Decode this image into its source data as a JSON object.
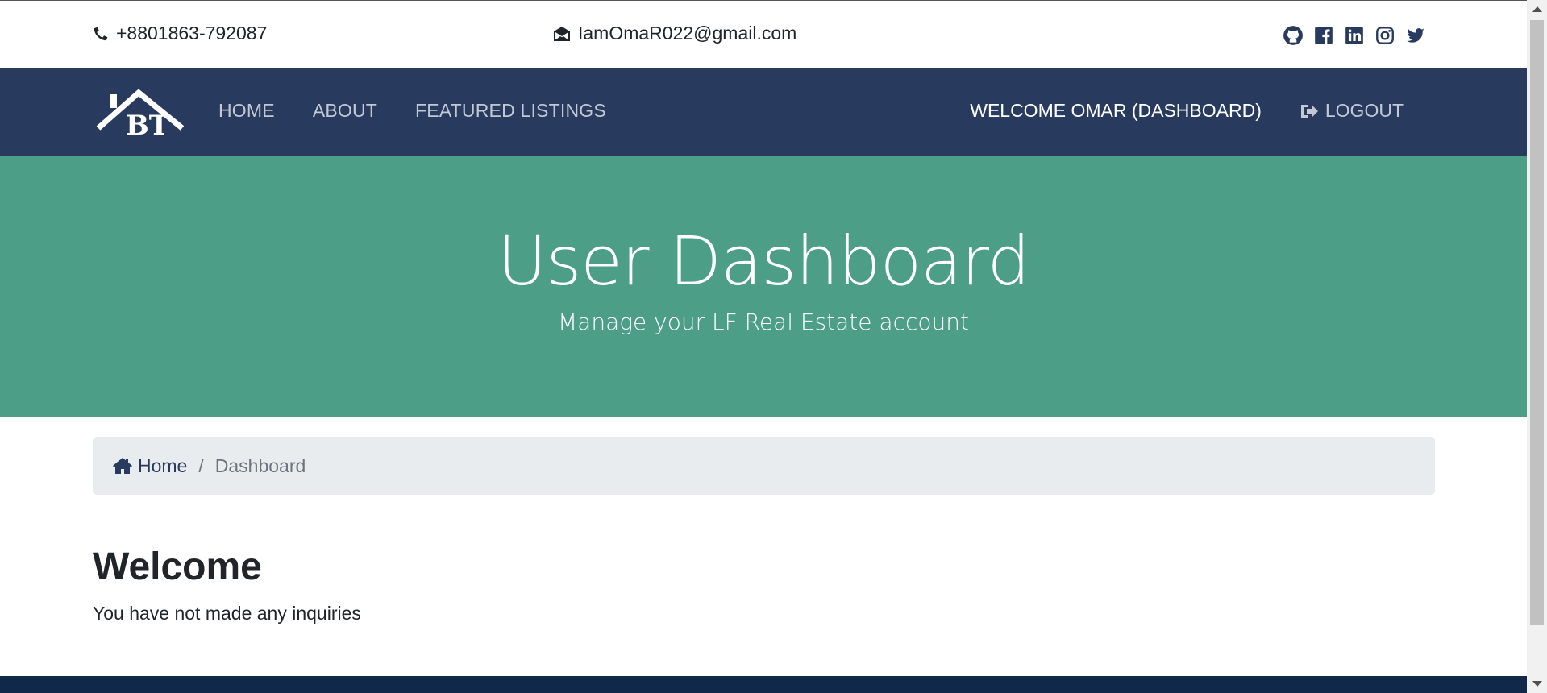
{
  "contact": {
    "phone": "+8801863-792087",
    "email": "IamOmaR022@gmail.com"
  },
  "social_icons": [
    "github-icon",
    "facebook-icon",
    "linkedin-icon",
    "instagram-icon",
    "twitter-icon"
  ],
  "nav": {
    "logo_text": "BT",
    "links": [
      "HOME",
      "ABOUT",
      "FEATURED LISTINGS"
    ],
    "welcome": "WELCOME OMAR (DASHBOARD)",
    "logout": "LOGOUT"
  },
  "showcase": {
    "title": "User Dashboard",
    "subtitle": "Manage your LF Real Estate account"
  },
  "breadcrumb": {
    "home": "Home",
    "separator": "/",
    "current": "Dashboard"
  },
  "main": {
    "heading": "Welcome",
    "message": "You have not made any inquiries"
  },
  "colors": {
    "navbar": "#283b5e",
    "showcase": "#4d9e87",
    "footer": "#10284a",
    "breadcrumb_bg": "#e9ecef"
  }
}
